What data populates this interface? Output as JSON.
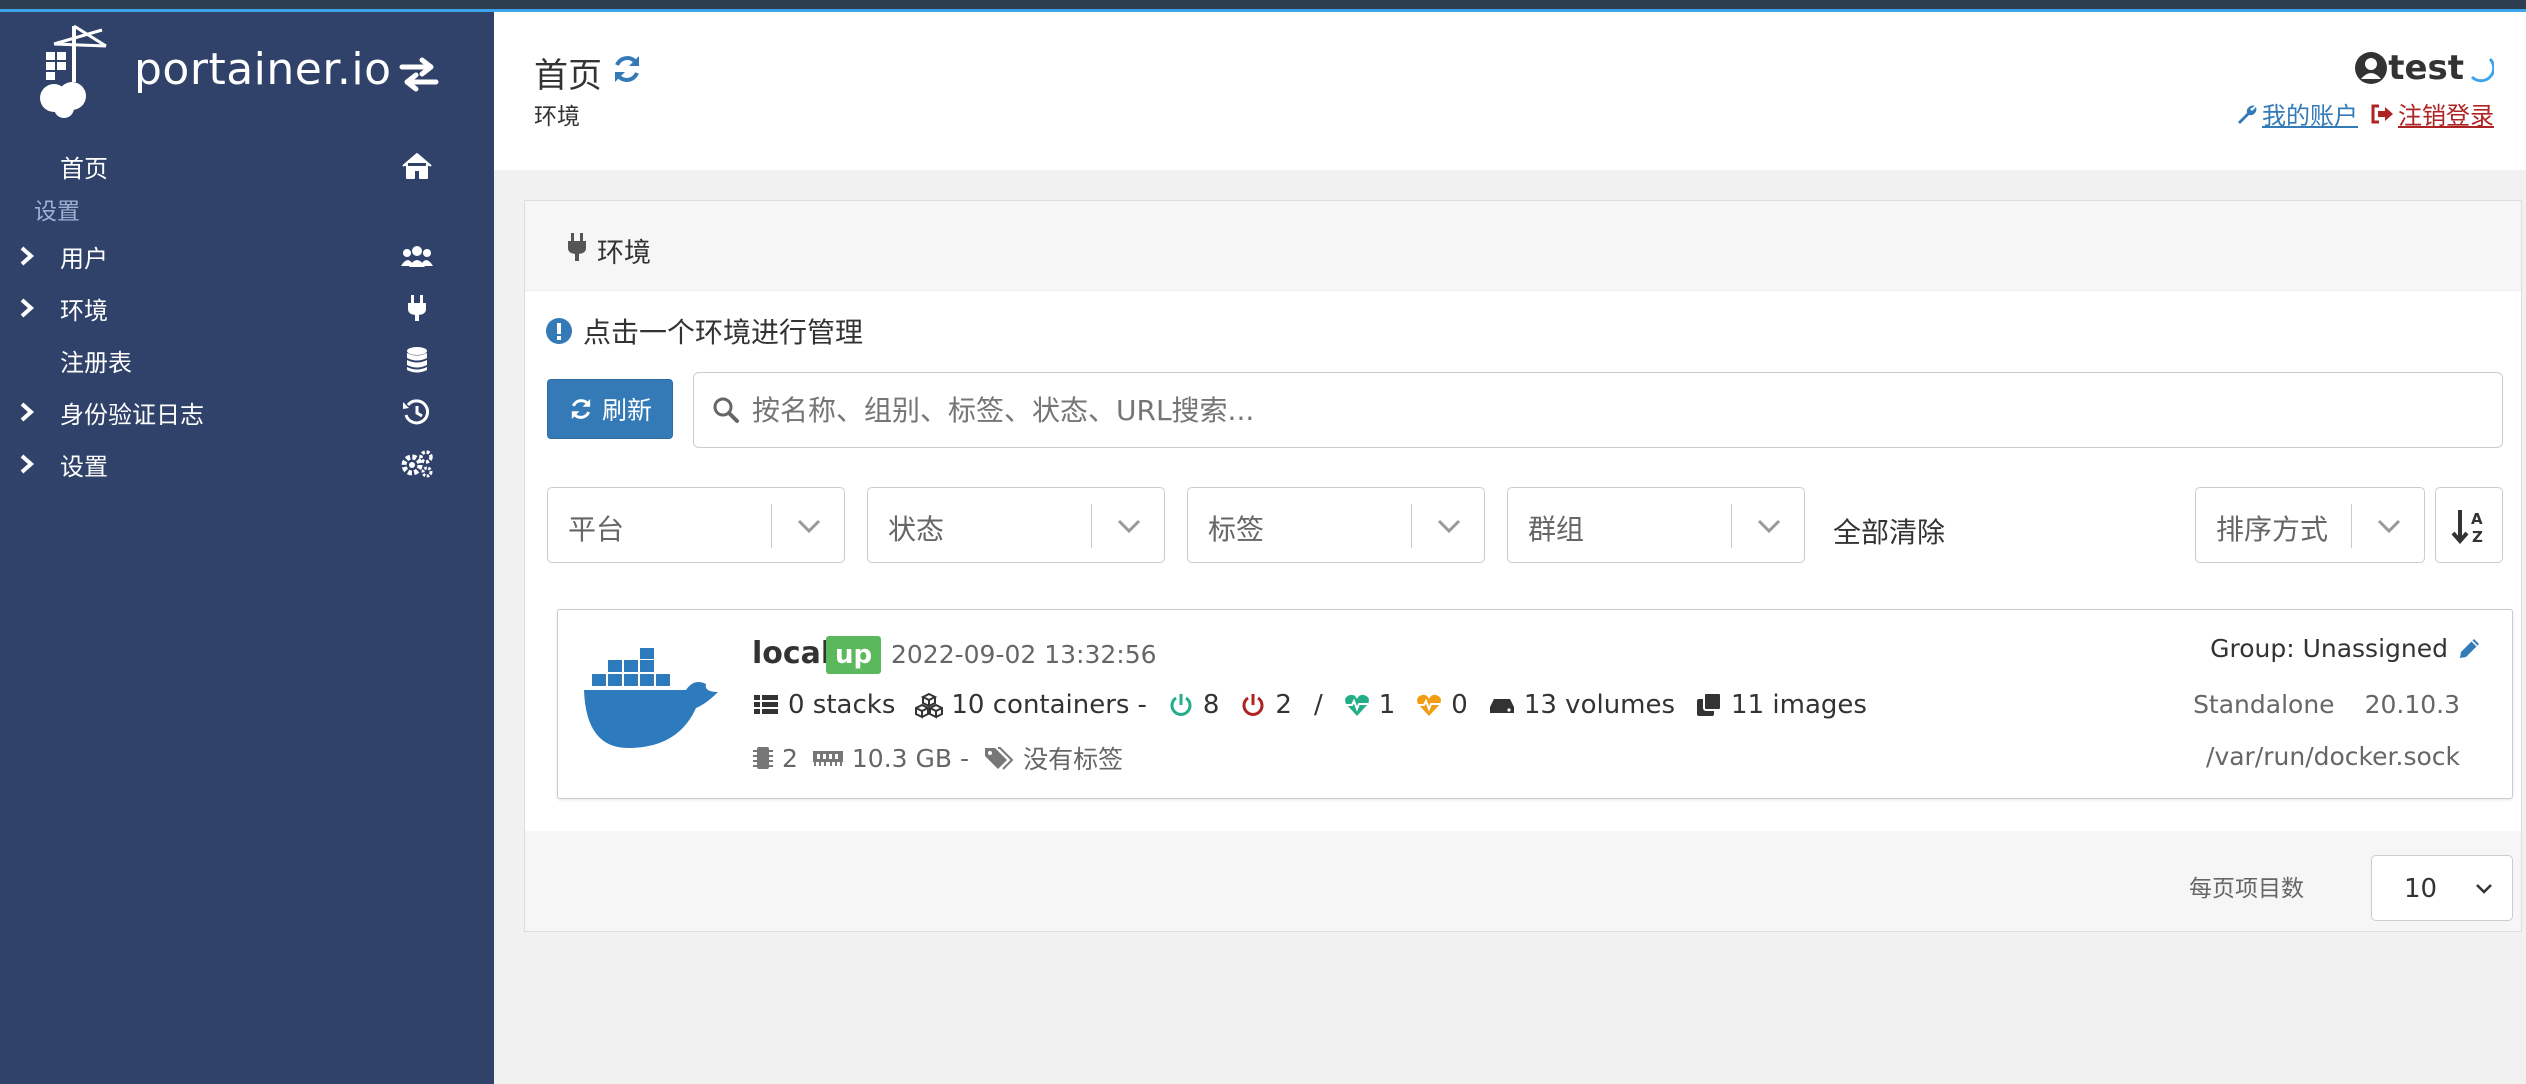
{
  "brand": {
    "logo_text": "portainer.io"
  },
  "sidebar": {
    "home_label": "首页",
    "section_label": "设置",
    "items": [
      {
        "label": "用户",
        "expandable": true,
        "icon": "users-icon"
      },
      {
        "label": "环境",
        "expandable": true,
        "icon": "plug-icon"
      },
      {
        "label": "注册表",
        "expandable": false,
        "icon": "database-icon"
      },
      {
        "label": "身份验证日志",
        "expandable": true,
        "icon": "history-icon"
      },
      {
        "label": "设置",
        "expandable": true,
        "icon": "cogs-icon"
      }
    ]
  },
  "header": {
    "title": "首页",
    "breadcrumb": "环境",
    "username": "test",
    "my_account": "我的账户",
    "logout": "注销登录"
  },
  "panel": {
    "title": "环境",
    "info": "点击一个环境进行管理",
    "refresh_label": "刷新",
    "search_placeholder": "按名称、组别、标签、状态、URL搜索...",
    "filters": [
      "平台",
      "状态",
      "标签",
      "群组"
    ],
    "clear_all": "全部清除",
    "sort_label": "排序方式",
    "per_page_label": "每页项目数",
    "per_page_value": "10"
  },
  "environment": {
    "name": "local",
    "status": "up",
    "timestamp": "2022-09-02 13:32:56",
    "stacks": "0 stacks",
    "containers": "10 containers",
    "running": "8",
    "stopped": "2",
    "healthy": "1",
    "unhealthy": "0",
    "volumes": "13 volumes",
    "images": "11 images",
    "cpu": "2",
    "memory": "10.3 GB",
    "tags": "没有标签",
    "group": "Group: Unassigned",
    "type": "Standalone",
    "version": "20.10.3",
    "url": "/var/run/docker.sock"
  },
  "colors": {
    "sidebar_bg": "#30426a",
    "primary": "#337ab7",
    "success": "#5cb85c",
    "running": "#23ae89",
    "stopped": "#ae2323",
    "unhealthy": "#f39c12",
    "logout": "#ae2323"
  }
}
